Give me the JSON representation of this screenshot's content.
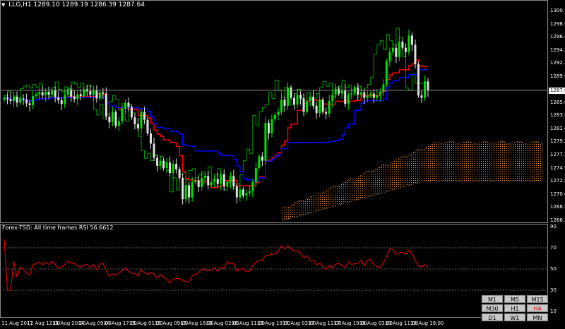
{
  "header": {
    "symbol_label": "LLG,H1",
    "ohlc": "1289.10 1289.19 1286.39 1287.64"
  },
  "indicator": {
    "title": "Forex-TSD: All time frames RSI 56.6612"
  },
  "colors": {
    "background": "#000000",
    "bull_candle": "#00e000",
    "bear_candle": "#e0e0e0",
    "red_line": "#ff0000",
    "blue_line": "#0000ff",
    "cloud": "#ff9933",
    "grid": "#606060"
  },
  "price_axis": {
    "ticks": [
      "1300.70",
      "1298.55",
      "1296.40",
      "1294.25",
      "1292.10",
      "1289.95",
      "1285.65",
      "1283.55",
      "1281.40",
      "1279.25",
      "1277.10",
      "1274.95",
      "1272.80",
      "1270.65",
      "1268.50",
      "1266.35"
    ],
    "current_price": "1287.64"
  },
  "rsi_axis": {
    "ticks": [
      "90",
      "70",
      "50",
      "30",
      "10"
    ],
    "current_value": "56.6612"
  },
  "time_axis": {
    "labels": [
      "11 Aug 2017",
      "11 Aug 12:00",
      "11 Aug 20:00",
      "14 Aug 09:00",
      "14 Aug 17:00",
      "15 Aug 01:00",
      "15 Aug 09:00",
      "15 Aug 18:00",
      "16 Aug 02:00",
      "16 Aug 11:00",
      "16 Aug 19:00",
      "17 Aug 03:00",
      "17 Aug 11:00",
      "17 Aug 19:00",
      "18 Aug 03:00",
      "18 Aug 11:00",
      "18 Aug 19:00"
    ]
  },
  "timeframes": {
    "buttons": [
      "M1",
      "M5",
      "M15",
      "M30",
      "H1",
      "H4",
      "D1",
      "W1",
      "MN"
    ],
    "active": "H4"
  },
  "chart_data": {
    "type": "candlestick",
    "ylim": [
      1266.35,
      1301.5
    ],
    "closes": [
      1286.4,
      1286.2,
      1285.9,
      1286.6,
      1285.6,
      1286.3,
      1286.1,
      1285.5,
      1285.2,
      1286.7,
      1287.0,
      1287.3,
      1286.8,
      1287.4,
      1286.9,
      1287.6,
      1286.5,
      1286.0,
      1285.4,
      1286.9,
      1287.8,
      1286.6,
      1286.2,
      1287.0,
      1286.7,
      1287.8,
      1287.5,
      1286.9,
      1287.6,
      1286.3,
      1287.3,
      1287.1,
      1283.3,
      1282.4,
      1284.1,
      1281.8,
      1282.6,
      1284.6,
      1285.6,
      1284.9,
      1283.2,
      1282.1,
      1281.4,
      1284.1,
      1282.8,
      1280.6,
      1278.9,
      1276.6,
      1275.3,
      1276.1,
      1274.9,
      1275.8,
      1274.1,
      1275.6,
      1274.7,
      1273.3,
      1269.8,
      1272.1,
      1270.1,
      1272.6,
      1272.9,
      1271.8,
      1273.3,
      1273.6,
      1272.1,
      1272.6,
      1273.1,
      1272.3,
      1273.9,
      1271.9,
      1272.6,
      1273.6,
      1271.9,
      1270.1,
      1271.4,
      1270.4,
      1270.8,
      1271.1,
      1272.6,
      1274.9,
      1276.8,
      1276.1,
      1282.3,
      1280.6,
      1282.9,
      1283.6,
      1284.1,
      1286.1,
      1285.1,
      1288.1,
      1286.4,
      1285.3,
      1286.9,
      1286.3,
      1284.1,
      1285.9,
      1286.6,
      1285.1,
      1283.9,
      1286.1,
      1284.1,
      1283.8,
      1285.9,
      1286.9,
      1287.9,
      1287.1,
      1287.6,
      1285.4,
      1286.9,
      1287.1,
      1288.1,
      1286.9,
      1287.3,
      1286.4,
      1286.8,
      1287.1,
      1286.4,
      1286.8,
      1287.4,
      1288.6,
      1292.4,
      1293.9,
      1294.6,
      1293.1,
      1295.6,
      1294.6,
      1293.9,
      1296.6,
      1295.1,
      1291.9,
      1286.8,
      1286.4,
      1289.1,
      1287.6
    ]
  }
}
